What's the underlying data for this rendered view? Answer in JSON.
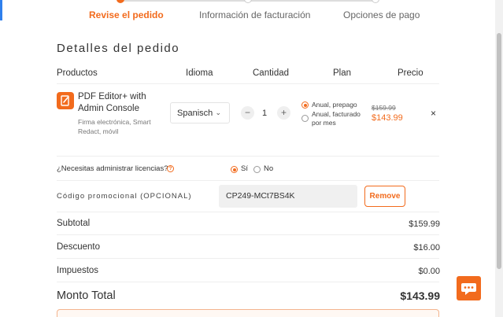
{
  "stepper": {
    "steps": [
      {
        "label": "Revise el pedido",
        "active": true
      },
      {
        "label": "Información de facturación",
        "active": false
      },
      {
        "label": "Opciones de pago",
        "active": false
      }
    ]
  },
  "order": {
    "title": "Detalles del pedido",
    "columns": {
      "products": "Productos",
      "language": "Idioma",
      "quantity": "Cantidad",
      "plan": "Plan",
      "price": "Precio"
    },
    "item": {
      "icon": "pdf-editor-icon",
      "name": "PDF Editor+ with Admin Console",
      "description": "Firma electrónica, Smart Redact, móvil",
      "language": "Spanisch",
      "quantity": "1",
      "decrement_label": "−",
      "increment_label": "+",
      "plans": [
        {
          "label": "Anual, prepago",
          "selected": true
        },
        {
          "label": "Anual, facturado por mes",
          "selected": false
        }
      ],
      "old_price": "$159.99",
      "price": "$143.99",
      "remove_label": "×"
    }
  },
  "licenses": {
    "question": "¿Necesitas administrar licencias?",
    "info_icon": "?",
    "options": [
      {
        "label": "Sí",
        "selected": true
      },
      {
        "label": "No",
        "selected": false
      }
    ]
  },
  "promo": {
    "label": "Código promocional (OPCIONAL)",
    "code": "CP249-MCt7BS4K",
    "remove_label": "Remove"
  },
  "summary": {
    "subtotal_label": "Subtotal",
    "subtotal": "$159.99",
    "discount_label": "Descuento",
    "discount": "$16.00",
    "taxes_label": "Impuestos",
    "taxes": "$0.00",
    "total_label": "Monto Total",
    "total": "$143.99"
  },
  "colors": {
    "accent": "#f26b1d",
    "text": "#333333",
    "muted": "#777777"
  },
  "icons": {
    "chat": "chat-icon",
    "chevron": "chevron-down-icon",
    "close": "close-icon",
    "info": "info-icon"
  }
}
